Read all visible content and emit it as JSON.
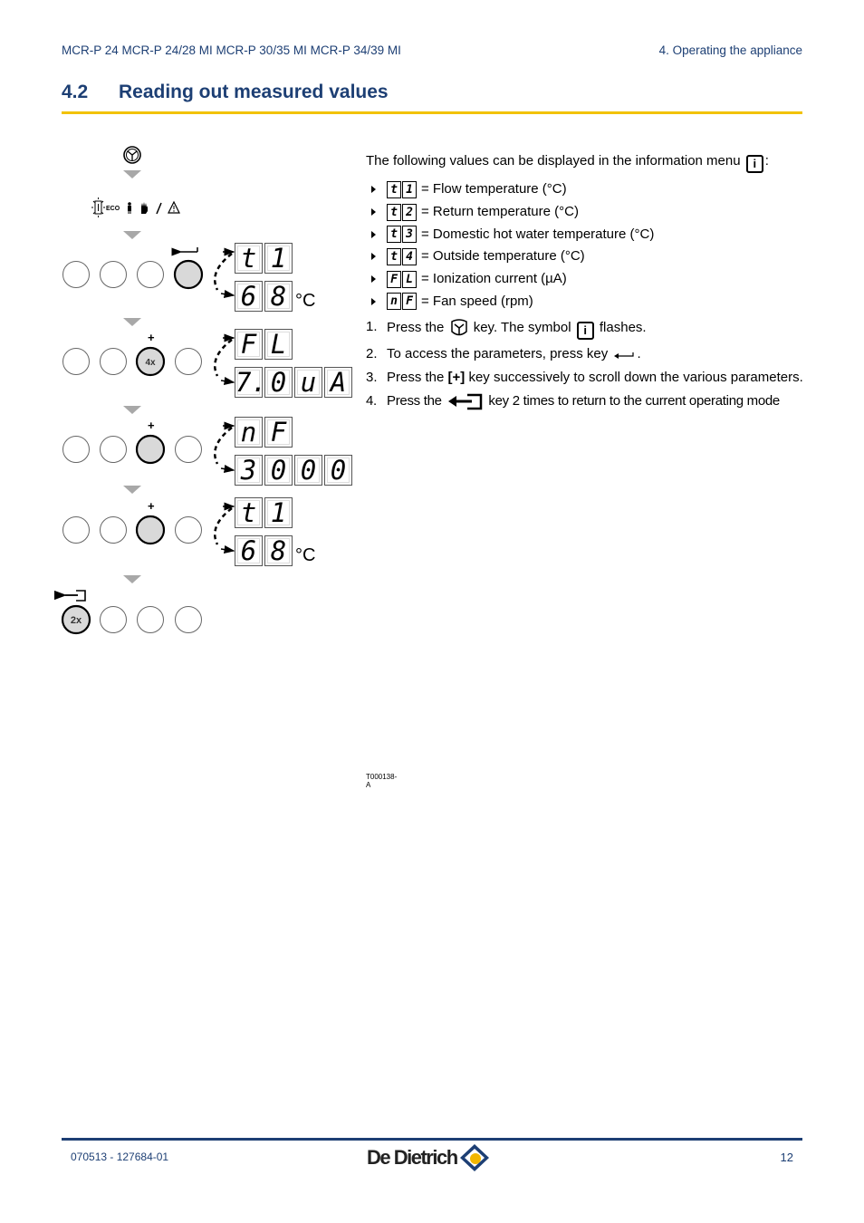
{
  "header": {
    "models": "MCR-P 24 MCR-P 24/28 MI MCR-P 30/35 MI MCR-P 34/39 MI",
    "chapter": "4.  Operating the appliance"
  },
  "section": {
    "number": "4.2",
    "title": "Reading out measured values"
  },
  "colors": {
    "brand_blue": "#1d3f74",
    "accent_yellow": "#f2c200",
    "button_fill": "#d9d9d9"
  },
  "figure": {
    "code": "T000138-A",
    "top_icons": [
      "menu-key-icon"
    ],
    "status_icons": [
      "info-flashing-icon",
      "eco-label",
      "person-icon",
      "hand-icon",
      "wrench-icon",
      "warning-icon"
    ],
    "eco_label": "ECO",
    "steps": [
      {
        "key_label": "↵",
        "key_press": "",
        "display_top": [
          "t",
          "1"
        ],
        "display_bottom": [
          "6",
          "8"
        ],
        "unit": "°C"
      },
      {
        "key_label": "+",
        "key_press": "4x",
        "display_top": [
          "F",
          "L"
        ],
        "display_bottom": [
          "7.",
          "0",
          "u",
          "A"
        ],
        "unit": ""
      },
      {
        "key_label": "+",
        "key_press": "",
        "display_top": [
          "n",
          "F"
        ],
        "display_bottom": [
          "3",
          "0",
          "0",
          "0"
        ],
        "unit": ""
      },
      {
        "key_label": "+",
        "key_press": "",
        "display_top": [
          "t",
          "1"
        ],
        "display_bottom": [
          "6",
          "8"
        ],
        "unit": "°C"
      },
      {
        "key_label": "exit",
        "key_press": "2x"
      }
    ]
  },
  "content": {
    "intro": "The following values can be displayed in the information menu",
    "intro_suffix": ":",
    "info_symbol": "i",
    "parameters": [
      {
        "code": [
          "t",
          "1"
        ],
        "desc": "= Flow temperature (°C)"
      },
      {
        "code": [
          "t",
          "2"
        ],
        "desc": "= Return temperature (°C)"
      },
      {
        "code": [
          "t",
          "3"
        ],
        "desc": "= Domestic hot water temperature (°C)"
      },
      {
        "code": [
          "t",
          "4"
        ],
        "desc": "= Outside temperature (°C)"
      },
      {
        "code": [
          "F",
          "L"
        ],
        "desc": "= Ionization current (µA)"
      },
      {
        "code": [
          "n",
          "F"
        ],
        "desc": "= Fan speed (rpm)"
      }
    ],
    "steps": [
      {
        "num": "1.",
        "pre": "Press the",
        "mid": "key. The symbol",
        "post": "flashes."
      },
      {
        "num": "2.",
        "pre": "To access the parameters, press key",
        "post": "."
      },
      {
        "num": "3.",
        "pre": "Press the",
        "bold": "[+]",
        "post": "key successively to scroll down the various parameters."
      },
      {
        "num": "4.",
        "pre": "Press the",
        "post": "key 2 times to return to the current operating mode"
      }
    ]
  },
  "footer": {
    "doc_code": "070513 - 127684-01",
    "brand": "De Dietrich",
    "page": "12"
  }
}
